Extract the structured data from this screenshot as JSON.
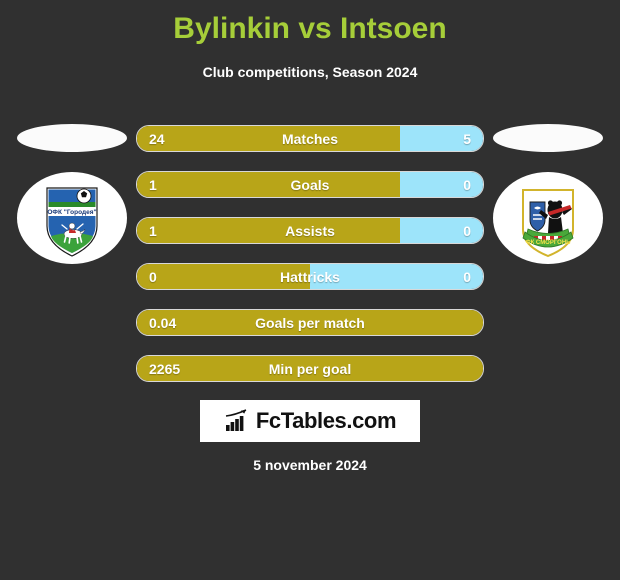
{
  "header": {
    "title": "Bylinkin vs Intsoen",
    "subtitle": "Club competitions, Season 2024",
    "title_color": "#a6ce39"
  },
  "colors": {
    "background": "#303030",
    "home_bar": "#b8a518",
    "away_bar": "#9de4fa",
    "text": "#ffffff"
  },
  "crests": {
    "home": {
      "name": "home-club-crest",
      "alt_text": "ОФК Городея",
      "caption": "ОФК 'Городея'"
    },
    "away": {
      "name": "away-club-crest",
      "alt_text": "ФК Сморгонь",
      "caption": "ФК СМОРГОНЬ"
    }
  },
  "chart_data": {
    "type": "bar",
    "title": "Bylinkin vs Intsoen",
    "subtitle": "Club competitions, Season 2024",
    "orientation": "horizontal-diverging",
    "series": [
      {
        "name": "Bylinkin",
        "side": "home",
        "color": "#b8a518"
      },
      {
        "name": "Intsoen",
        "side": "away",
        "color": "#9de4fa"
      }
    ],
    "categories": [
      "Matches",
      "Goals",
      "Assists",
      "Hattricks",
      "Goals per match",
      "Min per goal"
    ],
    "rows": [
      {
        "label": "Matches",
        "home_value": "24",
        "away_value": "5",
        "home_pct": 76,
        "single": false
      },
      {
        "label": "Goals",
        "home_value": "1",
        "away_value": "0",
        "home_pct": 76,
        "single": false
      },
      {
        "label": "Assists",
        "home_value": "1",
        "away_value": "0",
        "home_pct": 76,
        "single": false
      },
      {
        "label": "Hattricks",
        "home_value": "0",
        "away_value": "0",
        "home_pct": 50,
        "single": false
      },
      {
        "label": "Goals per match",
        "home_value": "0.04",
        "away_value": "",
        "home_pct": 100,
        "single": true
      },
      {
        "label": "Min per goal",
        "home_value": "2265",
        "away_value": "",
        "home_pct": 100,
        "single": true
      }
    ]
  },
  "footer": {
    "logo_text": "FcTables.com",
    "logo_icon": "bar-chart-growth-icon",
    "date": "5 november 2024"
  }
}
